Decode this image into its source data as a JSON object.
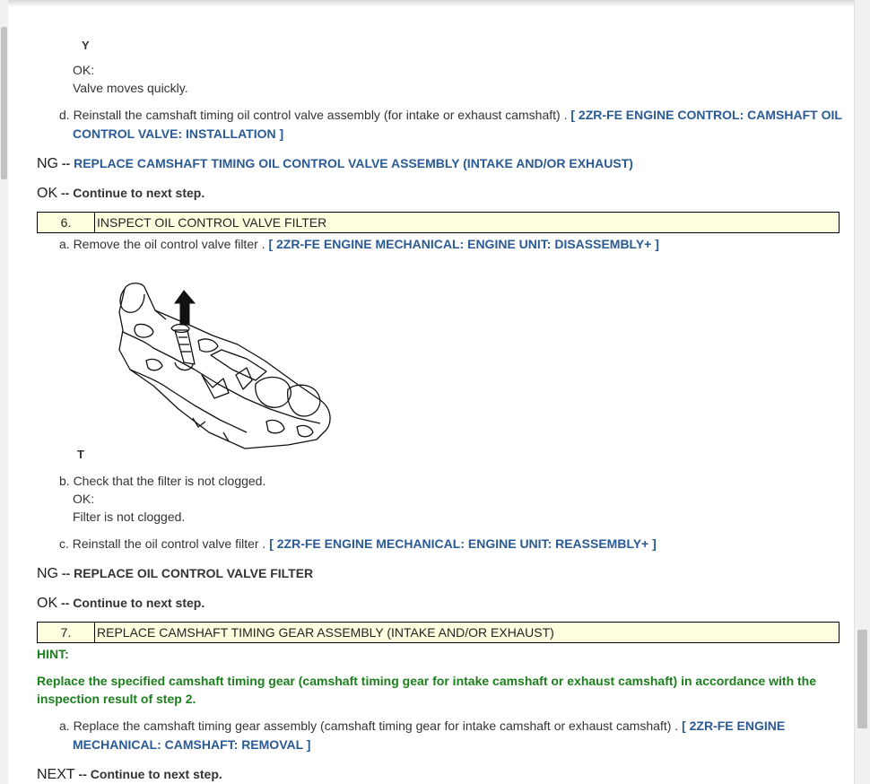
{
  "figure_top_label": "Y",
  "block1": {
    "ok_label": "OK:",
    "ok_value": "Valve moves quickly.",
    "step_d_prefix": "d. Reinstall the camshaft timing oil control valve assembly (for intake or exhaust camshaft) .",
    "step_d_link_line1": "[ 2ZR-FE ENGINE CONTROL: CAMSHAFT OIL",
    "step_d_link_line2": "CONTROL VALVE: INSTALLATION ]"
  },
  "result1": {
    "ng_label": "NG",
    "ng_sep": " -- ",
    "ng_text": "REPLACE CAMSHAFT TIMING OIL CONTROL VALVE ASSEMBLY (INTAKE AND/OR EXHAUST)",
    "ok_label": "OK",
    "ok_sep": " -- ",
    "ok_text": "Continue to next step."
  },
  "step6": {
    "number": "6.",
    "title": "INSPECT OIL CONTROL VALVE FILTER",
    "a_prefix": "a. Remove the oil control valve filter .",
    "a_link": "[ 2ZR-FE ENGINE MECHANICAL: ENGINE UNIT: DISASSEMBLY+ ]",
    "figure_label": "T",
    "figure_icon": "oil-control-valve-filter-diagram",
    "b_text": "b. Check that the filter is not clogged.",
    "b_ok_label": "OK:",
    "b_ok_value": "Filter is not clogged.",
    "c_prefix": "c. Reinstall the oil control valve filter .",
    "c_link": "[ 2ZR-FE ENGINE MECHANICAL: ENGINE UNIT: REASSEMBLY+ ]"
  },
  "result2": {
    "ng_label": "NG",
    "ng_sep": " -- ",
    "ng_text": "REPLACE OIL CONTROL VALVE FILTER",
    "ok_label": "OK",
    "ok_sep": " -- ",
    "ok_text": "Continue to next step."
  },
  "step7": {
    "number": "7.",
    "title": "REPLACE CAMSHAFT TIMING GEAR ASSEMBLY (INTAKE AND/OR EXHAUST)",
    "hint_label": "HINT:",
    "hint_line1": "Replace the specified camshaft timing gear (camshaft timing gear for intake camshaft or exhaust camshaft) in accordance with the",
    "hint_line2": "inspection result of step 2.",
    "a_prefix": "a. Replace the camshaft timing gear assembly (camshaft timing gear for intake camshaft or exhaust camshaft) .",
    "a_link_line1": "[ 2ZR-FE ENGINE",
    "a_link_line2": "MECHANICAL: CAMSHAFT: REMOVAL ]"
  },
  "result3": {
    "next_label": "NEXT",
    "next_sep": " -- ",
    "next_text": "Continue to next step."
  },
  "colors": {
    "link": "#2a5a95",
    "hint": "#1c7f1c",
    "step_box_bg": "#ffffe0"
  }
}
